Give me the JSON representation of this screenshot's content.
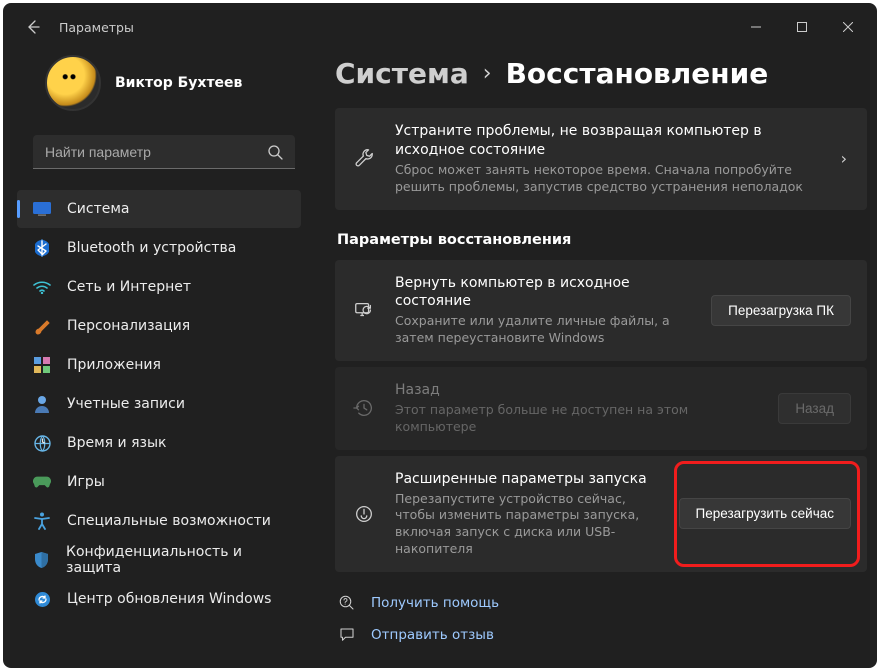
{
  "window": {
    "title": "Параметры"
  },
  "user": {
    "name": "Виктор Бухтеев",
    "sub": ""
  },
  "search": {
    "placeholder": "Найти параметр"
  },
  "nav": [
    {
      "id": "system",
      "label": "Система",
      "icon": "system",
      "active": true
    },
    {
      "id": "bluetooth",
      "label": "Bluetooth и устройства",
      "icon": "bluetooth"
    },
    {
      "id": "network",
      "label": "Сеть и Интернет",
      "icon": "wifi"
    },
    {
      "id": "personalization",
      "label": "Персонализация",
      "icon": "brush"
    },
    {
      "id": "apps",
      "label": "Приложения",
      "icon": "apps"
    },
    {
      "id": "accounts",
      "label": "Учетные записи",
      "icon": "person"
    },
    {
      "id": "time",
      "label": "Время и язык",
      "icon": "globe"
    },
    {
      "id": "gaming",
      "label": "Игры",
      "icon": "game"
    },
    {
      "id": "accessibility",
      "label": "Специальные возможности",
      "icon": "accessibility"
    },
    {
      "id": "privacy",
      "label": "Конфиденциальность и защита",
      "icon": "shield"
    },
    {
      "id": "update",
      "label": "Центр обновления Windows",
      "icon": "update"
    }
  ],
  "breadcrumb": {
    "root": "Система",
    "page": "Восстановление"
  },
  "troubleshoot": {
    "title": "Устраните проблемы, не возвращая компьютер в исходное состояние",
    "desc": "Сброс может занять некоторое время. Сначала попробуйте решить проблемы, запустив средство устранения неполадок"
  },
  "section": "Параметры восстановления",
  "reset": {
    "title": "Вернуть компьютер в исходное состояние",
    "desc": "Сохраните или удалите личные файлы, а затем переустановите Windows",
    "button": "Перезагрузка ПК"
  },
  "goback": {
    "title": "Назад",
    "desc": "Этот параметр больше не доступен на этом компьютере",
    "button": "Назад"
  },
  "advanced": {
    "title": "Расширенные параметры запуска",
    "desc": "Перезапустите устройство сейчас, чтобы изменить параметры запуска, включая запуск с диска или USB-накопителя",
    "button": "Перезагрузить сейчас"
  },
  "links": {
    "help": "Получить помощь",
    "feedback": "Отправить отзыв"
  }
}
